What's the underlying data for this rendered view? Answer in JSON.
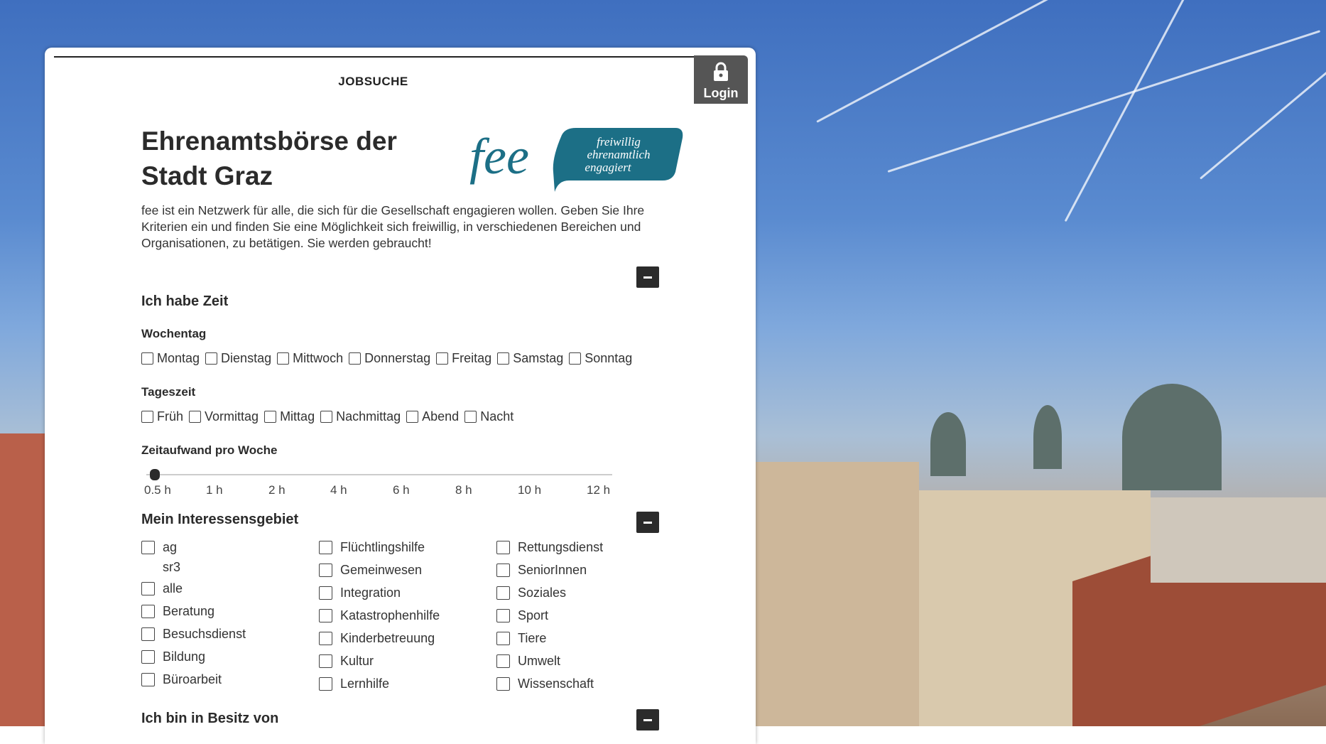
{
  "header": {
    "section_label": "JOBSUCHE",
    "login_label": "Login"
  },
  "hero": {
    "title_line1": "Ehrenamtsbörse der",
    "title_line2": "Stadt Graz",
    "logo_word": "fee",
    "logo_tag1": "freiwillig",
    "logo_tag2": "ehrenamtlich",
    "logo_tag3": "engagiert",
    "intro": "fee ist ein Netzwerk für alle, die sich für die Gesellschaft engagieren wollen. Geben Sie Ihre Kriterien ein und finden Sie eine Möglichkeit sich freiwillig, in verschiedenen Bereichen und Organisationen, zu betätigen. Sie werden gebraucht!"
  },
  "time": {
    "heading": "Ich habe Zeit",
    "weekday_label": "Wochentag",
    "weekdays": [
      "Montag",
      "Dienstag",
      "Mittwoch",
      "Donnerstag",
      "Freitag",
      "Samstag",
      "Sonntag"
    ],
    "daytime_label": "Tageszeit",
    "daytimes": [
      "Früh",
      "Vormittag",
      "Mittag",
      "Nachmittag",
      "Abend",
      "Nacht"
    ],
    "effort_label": "Zeitaufwand pro Woche",
    "effort_ticks": [
      "0.5 h",
      "1 h",
      "2 h",
      "4 h",
      "6 h",
      "8 h",
      "10 h",
      "12 h"
    ],
    "effort_value": "0.5 h"
  },
  "interests": {
    "heading": "Mein Interessensgebiet",
    "col1": [
      "ag",
      "sr3",
      "alle",
      "Beratung",
      "Besuchsdienst",
      "Bildung",
      "Büroarbeit"
    ],
    "col2": [
      "Flüchtlingshilfe",
      "Gemeinwesen",
      "Integration",
      "Katastrophenhilfe",
      "Kinderbetreuung",
      "Kultur",
      "Lernhilfe"
    ],
    "col3": [
      "Rettungsdienst",
      "SeniorInnen",
      "Soziales",
      "Sport",
      "Tiere",
      "Umwelt",
      "Wissenschaft"
    ]
  },
  "possession": {
    "heading": "Ich bin in Besitz von"
  },
  "colors": {
    "brand_teal": "#1c6f86",
    "dark_button": "#2b2b2b",
    "login_bg": "#555555"
  }
}
